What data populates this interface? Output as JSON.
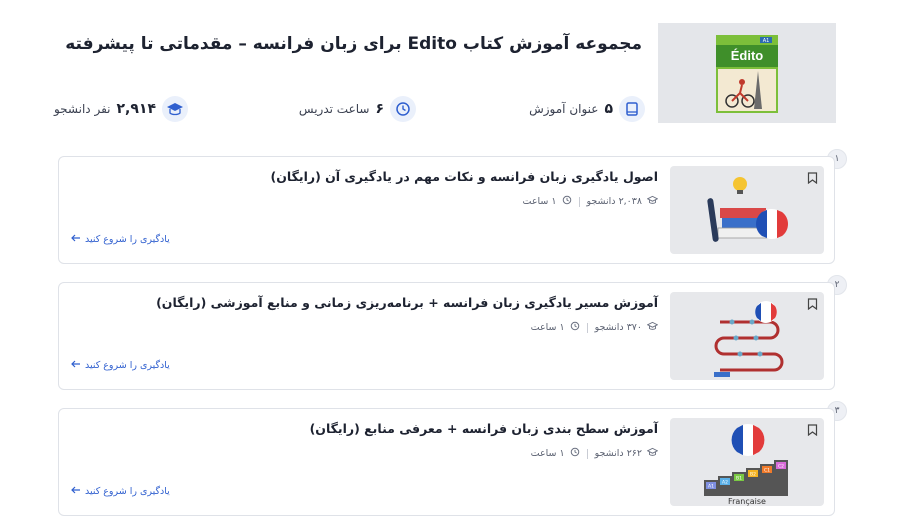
{
  "course": {
    "title": "مجموعه آموزش کتاب Edito برای زبان فرانسه – مقدماتی تا پیشرفته",
    "cover_text": "Édito",
    "stats": {
      "lessons": {
        "value": "۵",
        "label": "عنوان آموزش",
        "icon": "book-icon"
      },
      "hours": {
        "value": "۶",
        "label": "ساعت تدریس",
        "icon": "clock-icon"
      },
      "students": {
        "value": "۲,۹۱۴",
        "label": "نفر دانشجو",
        "icon": "graduation-cap-icon"
      }
    }
  },
  "lessons": [
    {
      "index": "۱",
      "title": "اصول یادگیری زبان فرانسه و نکات مهم در یادگیری آن (رایگان)",
      "students": "۲,۰۳۸ دانشجو",
      "duration": "۱ ساعت",
      "cta": "یادگیری را شروع کنید"
    },
    {
      "index": "۲",
      "title": "آموزش مسیر یادگیری زبان فرانسه + برنامه‌ریزی زمانی و منابع آموزشی (رایگان)",
      "students": "۳۷۰ دانشجو",
      "duration": "۱ ساعت",
      "cta": "یادگیری را شروع کنید"
    },
    {
      "index": "۳",
      "title": "آموزش سطح بندی زبان فرانسه + معرفی منابع (رایگان)",
      "students": "۲۶۲ دانشجو",
      "duration": "۱ ساعت",
      "cta": "یادگیری را شروع کنید",
      "levels": [
        "A1",
        "A2",
        "B1",
        "B2",
        "C1",
        "C2"
      ],
      "caption": "Française"
    }
  ],
  "colors": {
    "accent": "#2f5fcf",
    "icon_bg": "#eaf0fb",
    "flag_blue": "#1f4fb5",
    "flag_red": "#e23b3b"
  }
}
